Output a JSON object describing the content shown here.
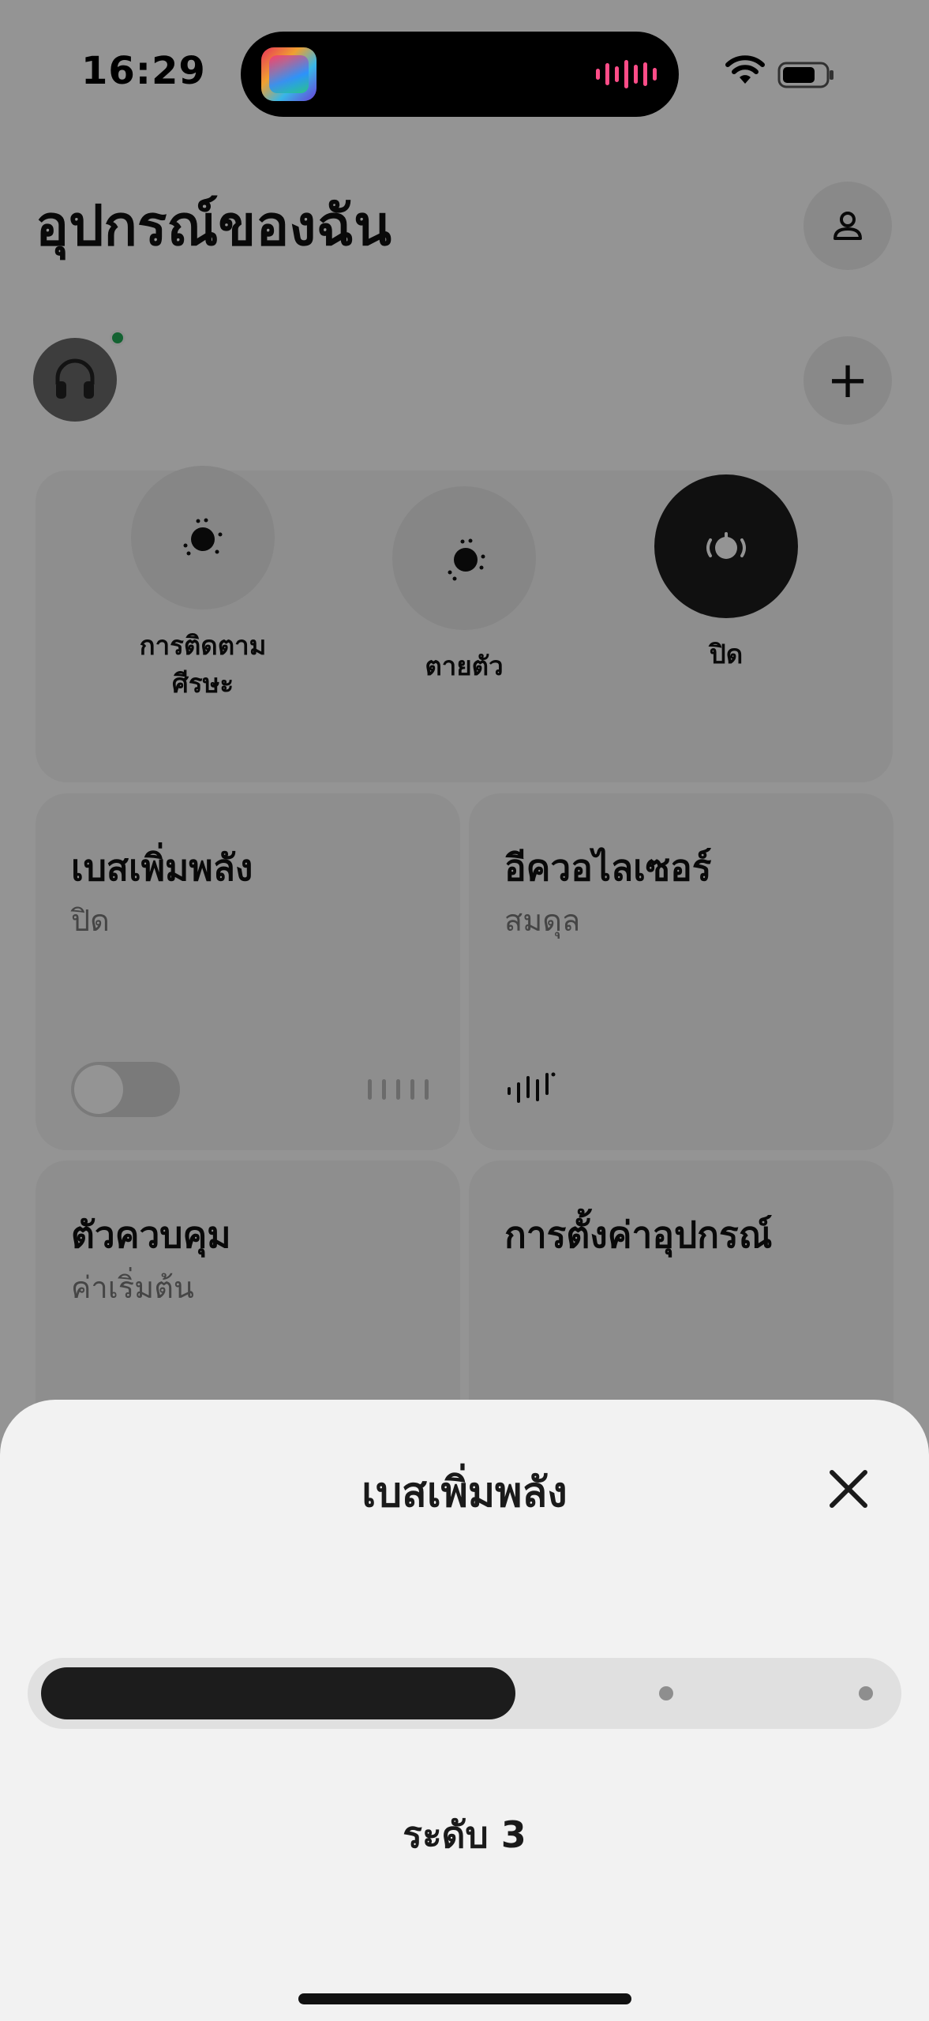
{
  "status_bar": {
    "time": "16:29"
  },
  "header": {
    "title": "อุปกรณ์ของฉัน"
  },
  "modes": [
    {
      "label": "การติดตาม\nศีรษะ",
      "active": false
    },
    {
      "label": "ตายตัว",
      "active": false
    },
    {
      "label": "ปิด",
      "active": true
    }
  ],
  "tiles": {
    "bass": {
      "title": "เบสเพิ่มพลัง",
      "subtitle": "ปิด",
      "enabled": false
    },
    "eq": {
      "title": "อีควอไลเซอร์",
      "subtitle": "สมดุล"
    },
    "controls": {
      "title": "ตัวควบคุม",
      "subtitle": "ค่าเริ่มต้น"
    },
    "device_settings": {
      "title": "การตั้งค่าอุปกรณ์"
    }
  },
  "sheet": {
    "title": "เบสเพิ่มพลัง",
    "level_label": "ระดับ 3",
    "slider_fraction": 0.56
  },
  "colors": {
    "accent": "#1c1c1c",
    "online": "#22aa55",
    "island_wave": "#ff4d88"
  },
  "icons": [
    "person-icon",
    "plus-icon",
    "headphones-icon",
    "close-icon",
    "wifi-icon",
    "battery-icon",
    "equalizer-icon"
  ]
}
